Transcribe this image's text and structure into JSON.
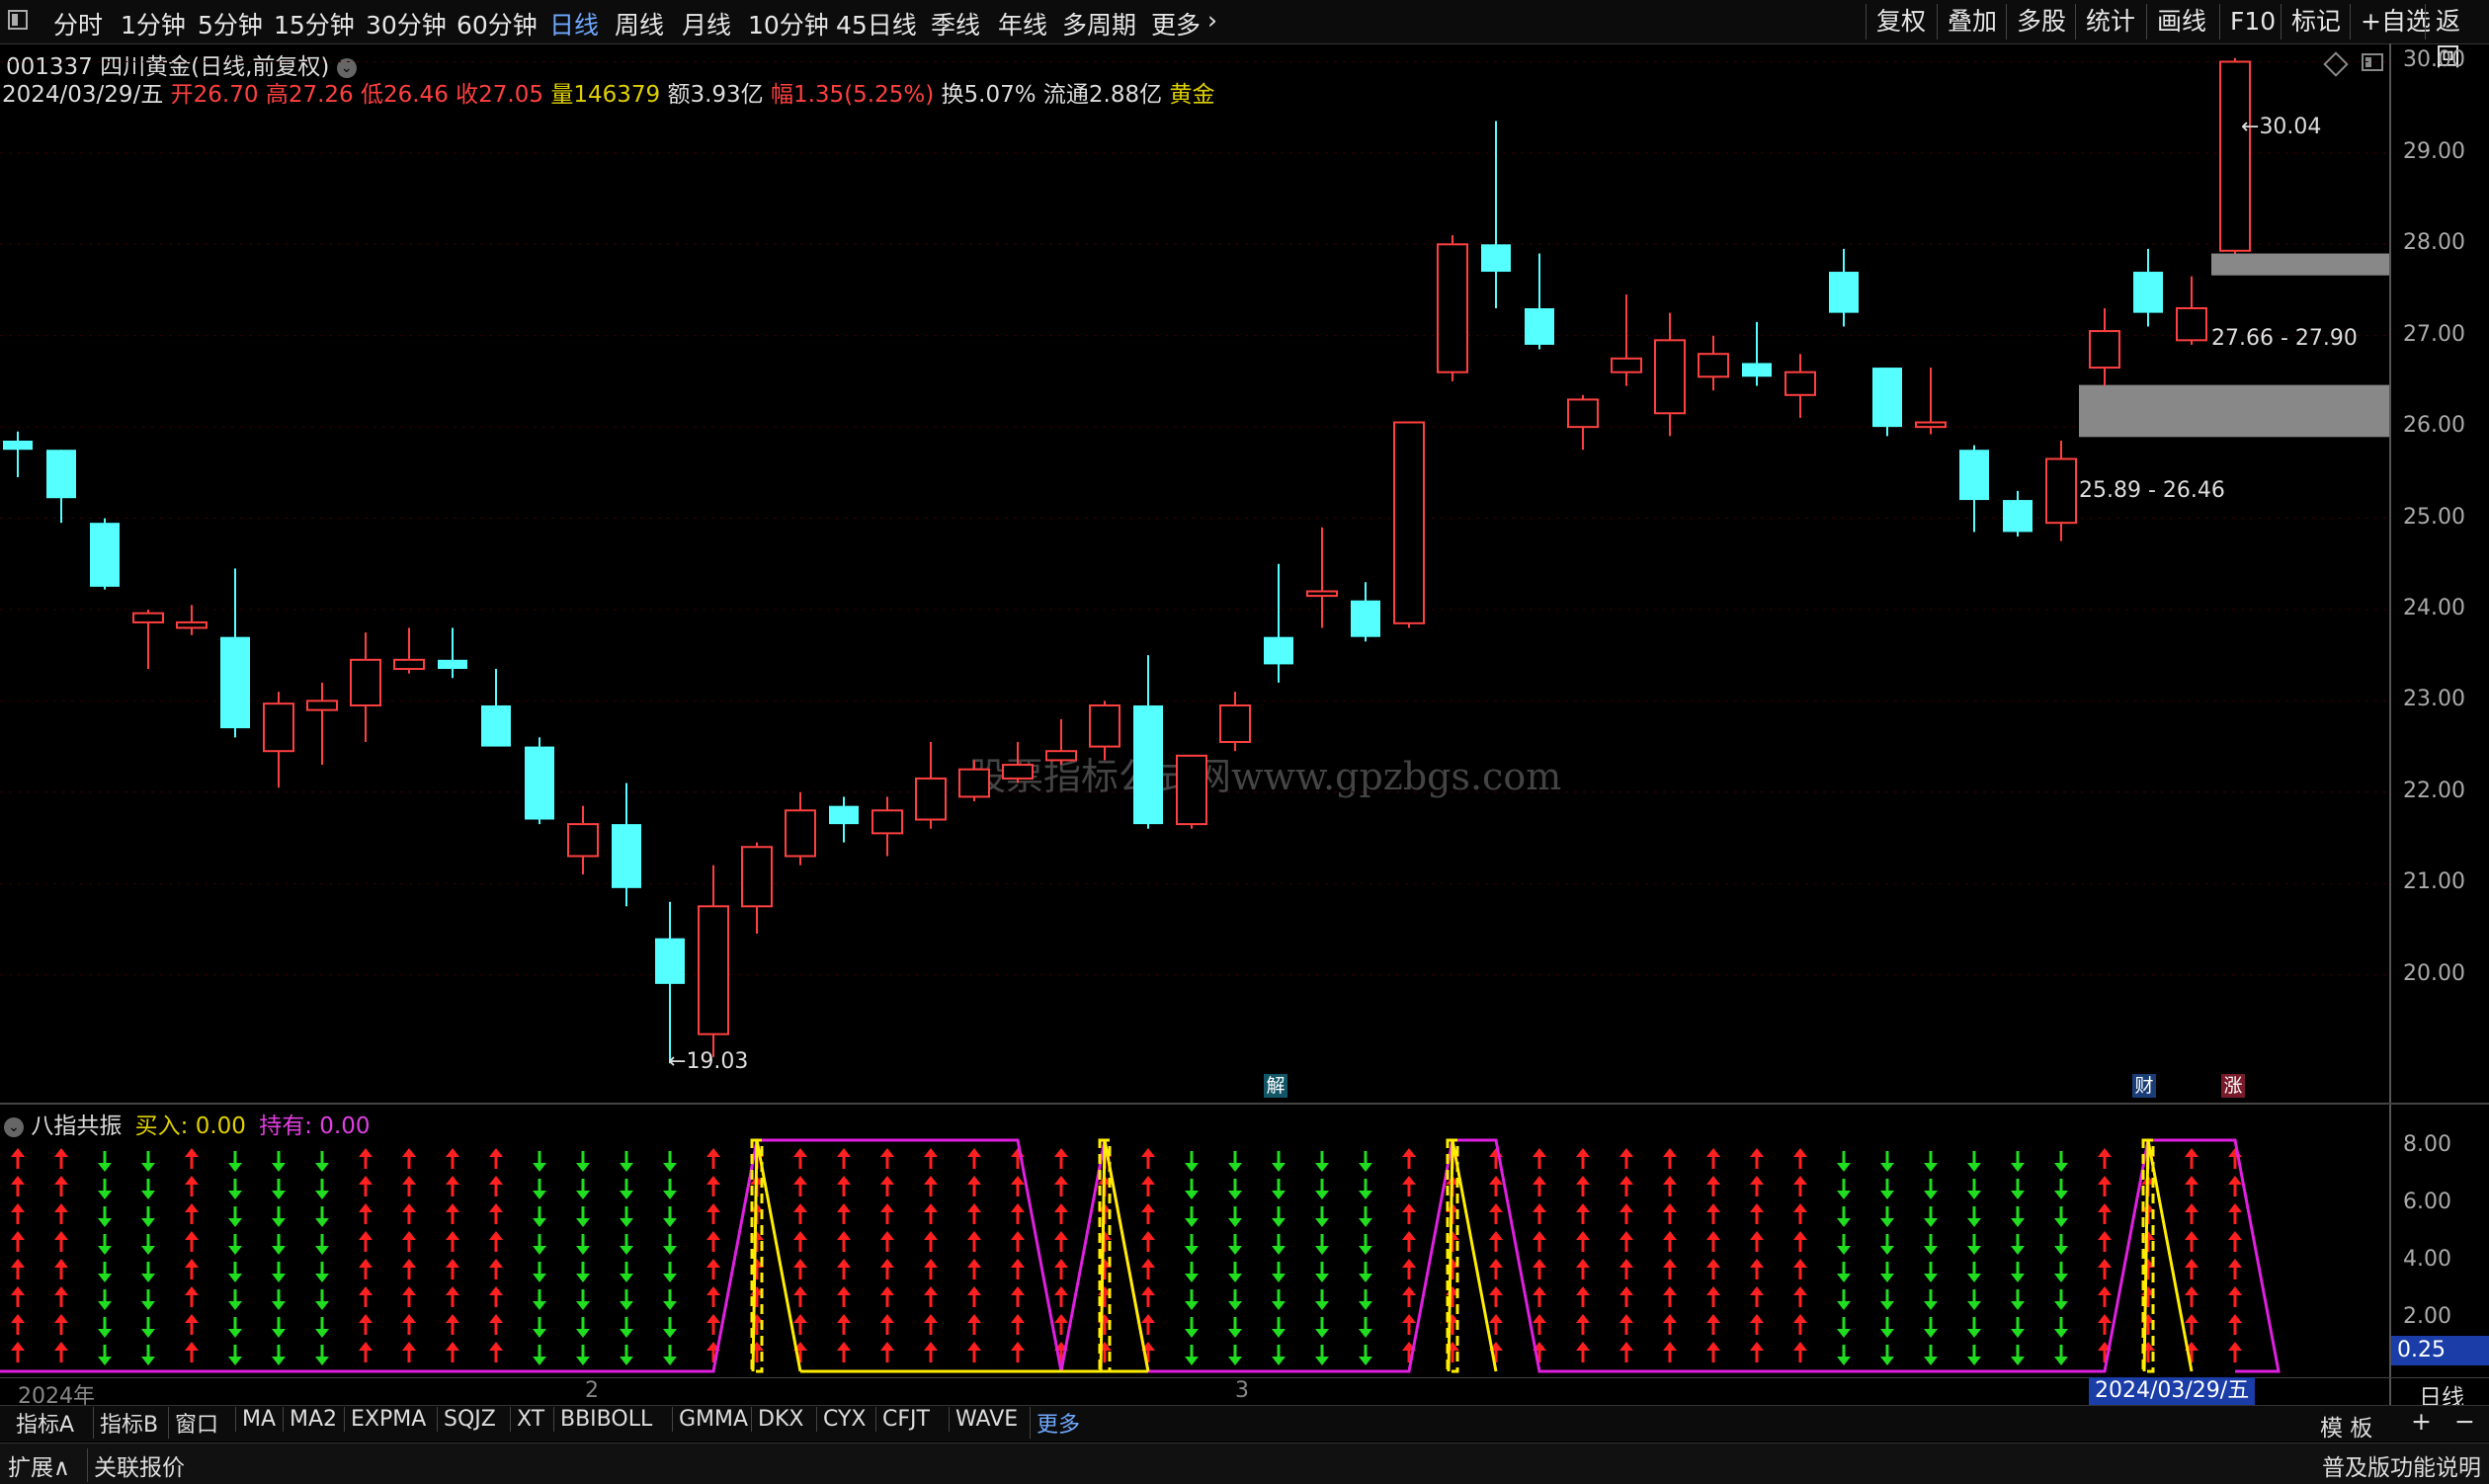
{
  "toolbar": {
    "periods": [
      "分时",
      "1分钟",
      "5分钟",
      "15分钟",
      "30分钟",
      "60分钟",
      "日线",
      "周线",
      "月线",
      "10分钟",
      "45日线",
      "季线",
      "年线",
      "多周期",
      "更多"
    ],
    "active_period": "日线",
    "right_buttons": [
      "复权",
      "叠加",
      "多股",
      "统计",
      "画线",
      "F10",
      "标记",
      "+自选",
      "返回"
    ]
  },
  "stock": {
    "code_name": "001337 四川黄金(日线,前复权)",
    "date": "2024/03/29/五",
    "open_label": "开",
    "open": "26.70",
    "high_label": "高",
    "high": "27.26",
    "low_label": "低",
    "low": "26.46",
    "close_label": "收",
    "close": "27.05",
    "vol_label": "量",
    "vol": "146379",
    "amount_label": "额",
    "amount": "3.93亿",
    "change_label": "幅",
    "change": "1.35(5.25%)",
    "turnover_label": "换",
    "turnover": "5.07%",
    "float_label": "流通",
    "float": "2.88亿",
    "sector": "黄金"
  },
  "price_axis": [
    "30.00",
    "29.00",
    "28.00",
    "27.00",
    "26.00",
    "25.00",
    "24.00",
    "23.00",
    "22.00",
    "21.00",
    "20.00"
  ],
  "annotations": {
    "high_mark": "30.04",
    "low_mark": "19.03",
    "gap_upper": "27.66 - 27.90",
    "gap_lower": "25.89 - 26.46",
    "watermark": "股票指标公式网www.gpzbgs.com",
    "event_jie": "解",
    "event_cai": "财",
    "event_zhang": "涨"
  },
  "indicator": {
    "name": "八指共振",
    "buy_label": "买入:",
    "buy_value": "0.00",
    "hold_label": "持有:",
    "hold_value": "0.00",
    "axis": [
      "8.00",
      "6.00",
      "4.00",
      "2.00"
    ],
    "current_value": "0.25"
  },
  "x_axis": {
    "labels": [
      "2024年",
      "2",
      "3"
    ],
    "current_date": "2024/03/29/五",
    "period": "日线"
  },
  "bottom_tabs": [
    "指标A",
    "指标B",
    "窗口",
    "MA",
    "MA2",
    "EXPMA",
    "SQJZ",
    "XT",
    "BBIBOLL",
    "GMMA",
    "DKX",
    "CYX",
    "CFJT",
    "WAVE",
    "更多"
  ],
  "bottom_right": {
    "template": "模 板",
    "plus": "+",
    "minus": "−"
  },
  "status_bar": {
    "expand": "扩展∧",
    "related": "关联报价",
    "right": "普及版功能说明"
  },
  "colors": {
    "up": "#ff4040",
    "down": "#55ffff",
    "background": "#000000",
    "highlight": "#6fa8ff"
  },
  "chart_data": {
    "type": "candlestick",
    "ylim": [
      18.6,
      30.2
    ],
    "candles": [
      {
        "o": 25.85,
        "h": 25.95,
        "l": 25.45,
        "c": 25.75
      },
      {
        "o": 25.75,
        "h": 25.75,
        "l": 24.95,
        "c": 25.22
      },
      {
        "o": 24.95,
        "h": 25.0,
        "l": 24.22,
        "c": 24.25
      },
      {
        "o": 23.86,
        "h": 24.0,
        "l": 23.35,
        "c": 23.96
      },
      {
        "o": 23.8,
        "h": 24.05,
        "l": 23.72,
        "c": 23.86
      },
      {
        "o": 23.7,
        "h": 24.45,
        "l": 22.6,
        "c": 22.7
      },
      {
        "o": 22.45,
        "h": 23.1,
        "l": 22.05,
        "c": 22.97
      },
      {
        "o": 22.9,
        "h": 23.2,
        "l": 22.3,
        "c": 23.0
      },
      {
        "o": 22.95,
        "h": 23.75,
        "l": 22.55,
        "c": 23.45
      },
      {
        "o": 23.35,
        "h": 23.8,
        "l": 23.3,
        "c": 23.45
      },
      {
        "o": 23.45,
        "h": 23.8,
        "l": 23.25,
        "c": 23.35
      },
      {
        "o": 22.95,
        "h": 23.35,
        "l": 22.5,
        "c": 22.5
      },
      {
        "o": 22.5,
        "h": 22.6,
        "l": 21.65,
        "c": 21.7
      },
      {
        "o": 21.3,
        "h": 21.85,
        "l": 21.1,
        "c": 21.65
      },
      {
        "o": 21.65,
        "h": 22.1,
        "l": 20.75,
        "c": 20.95
      },
      {
        "o": 20.4,
        "h": 20.8,
        "l": 19.03,
        "c": 19.9
      },
      {
        "o": 19.35,
        "h": 21.2,
        "l": 19.1,
        "c": 20.75
      },
      {
        "o": 20.75,
        "h": 21.45,
        "l": 20.45,
        "c": 21.4
      },
      {
        "o": 21.3,
        "h": 22.0,
        "l": 21.2,
        "c": 21.8
      },
      {
        "o": 21.85,
        "h": 21.95,
        "l": 21.45,
        "c": 21.65
      },
      {
        "o": 21.55,
        "h": 21.95,
        "l": 21.3,
        "c": 21.8
      },
      {
        "o": 21.7,
        "h": 22.55,
        "l": 21.6,
        "c": 22.15
      },
      {
        "o": 21.95,
        "h": 22.35,
        "l": 21.9,
        "c": 22.25
      },
      {
        "o": 22.15,
        "h": 22.55,
        "l": 22.1,
        "c": 22.3
      },
      {
        "o": 22.35,
        "h": 22.8,
        "l": 22.3,
        "c": 22.45
      },
      {
        "o": 22.5,
        "h": 23.0,
        "l": 22.35,
        "c": 22.95
      },
      {
        "o": 22.95,
        "h": 23.5,
        "l": 21.6,
        "c": 21.65
      },
      {
        "o": 21.65,
        "h": 22.4,
        "l": 21.6,
        "c": 22.4
      },
      {
        "o": 22.55,
        "h": 23.1,
        "l": 22.45,
        "c": 22.95
      },
      {
        "o": 23.7,
        "h": 24.5,
        "l": 23.2,
        "c": 23.4
      },
      {
        "o": 24.15,
        "h": 24.9,
        "l": 23.8,
        "c": 24.2
      },
      {
        "o": 24.1,
        "h": 24.3,
        "l": 23.65,
        "c": 23.7
      },
      {
        "o": 23.85,
        "h": 26.05,
        "l": 23.8,
        "c": 26.05
      },
      {
        "o": 26.6,
        "h": 28.1,
        "l": 26.5,
        "c": 28.0
      },
      {
        "o": 28.0,
        "h": 29.35,
        "l": 27.3,
        "c": 27.7
      },
      {
        "o": 27.3,
        "h": 27.9,
        "l": 26.85,
        "c": 26.9
      },
      {
        "o": 26.0,
        "h": 26.35,
        "l": 25.75,
        "c": 26.3
      },
      {
        "o": 26.6,
        "h": 27.45,
        "l": 26.45,
        "c": 26.75
      },
      {
        "o": 26.15,
        "h": 27.25,
        "l": 25.9,
        "c": 26.95
      },
      {
        "o": 26.55,
        "h": 27.0,
        "l": 26.4,
        "c": 26.8
      },
      {
        "o": 26.7,
        "h": 27.15,
        "l": 26.45,
        "c": 26.55
      },
      {
        "o": 26.35,
        "h": 26.8,
        "l": 26.1,
        "c": 26.6
      },
      {
        "o": 27.7,
        "h": 27.95,
        "l": 27.1,
        "c": 27.25
      },
      {
        "o": 26.65,
        "h": 26.65,
        "l": 25.9,
        "c": 26.0
      },
      {
        "o": 26.0,
        "h": 26.65,
        "l": 25.92,
        "c": 26.05
      },
      {
        "o": 25.75,
        "h": 25.8,
        "l": 24.85,
        "c": 25.2
      },
      {
        "o": 25.2,
        "h": 25.3,
        "l": 24.8,
        "c": 24.85
      },
      {
        "o": 24.95,
        "h": 25.85,
        "l": 24.75,
        "c": 25.65
      },
      {
        "o": 26.65,
        "h": 27.3,
        "l": 26.45,
        "c": 27.05
      },
      {
        "o": 27.7,
        "h": 27.95,
        "l": 27.1,
        "c": 27.25
      },
      {
        "o": 26.95,
        "h": 27.65,
        "l": 26.9,
        "c": 27.3
      },
      {
        "o": 27.93,
        "h": 30.04,
        "l": 27.9,
        "c": 30.0
      }
    ],
    "signal_up": [
      1,
      1,
      0,
      0,
      1,
      0,
      0,
      0,
      1,
      1,
      1,
      1,
      0,
      0,
      0,
      0,
      1,
      1,
      1,
      1,
      1,
      1,
      1,
      1,
      1,
      1,
      1,
      0,
      0,
      0,
      0,
      0,
      1,
      1,
      1,
      1,
      1,
      1,
      1,
      1,
      1,
      1,
      0,
      0,
      0,
      0,
      0,
      0,
      1,
      1,
      1,
      1
    ],
    "buy_signal_bars": [
      17,
      25,
      33,
      49
    ],
    "buy_line_high": [
      [
        17,
        23
      ],
      [
        25,
        25
      ],
      [
        33,
        34
      ],
      [
        49,
        51
      ]
    ]
  }
}
